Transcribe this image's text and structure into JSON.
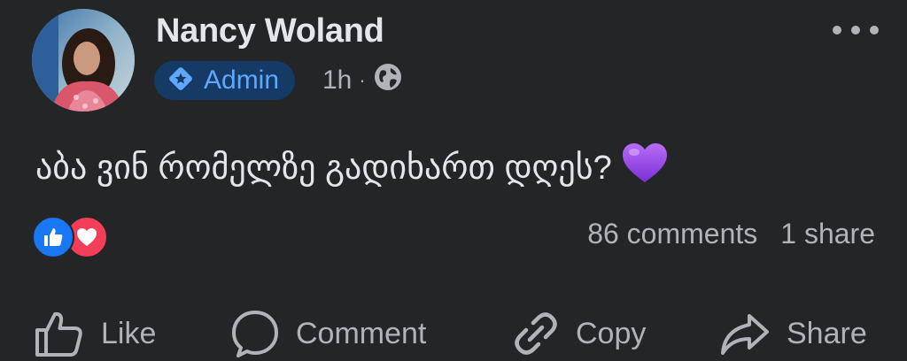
{
  "post": {
    "author": {
      "name": "Nancy Woland"
    },
    "badge": {
      "label": "Admin",
      "icon": "admin-diamond-icon"
    },
    "meta": {
      "time": "1h",
      "separator": "·",
      "audience_icon": "globe-icon"
    },
    "more_icon": "more-horizontal-icon",
    "text": "აბა ვინ რომელზე გადიხართ დღეს?",
    "emoji": "purple-heart-emoji",
    "reactions": {
      "icons": [
        "like-reaction-icon",
        "love-reaction-icon"
      ]
    },
    "counts": {
      "comments": "86 comments",
      "shares": "1 share"
    },
    "actions": [
      {
        "label": "Like",
        "icon": "thumbs-up-icon"
      },
      {
        "label": "Comment",
        "icon": "comment-bubble-icon"
      },
      {
        "label": "Copy",
        "icon": "link-icon"
      },
      {
        "label": "Share",
        "icon": "share-arrow-icon"
      }
    ]
  },
  "colors": {
    "background": "#242526",
    "primary_text": "#e4e6eb",
    "secondary_text": "#b0b3b8",
    "badge_bg": "#163a66",
    "badge_text": "#5fa7ff",
    "like_blue": "#1877f2",
    "love_red": "#f33e58",
    "heart_purple": "#a855f7"
  }
}
